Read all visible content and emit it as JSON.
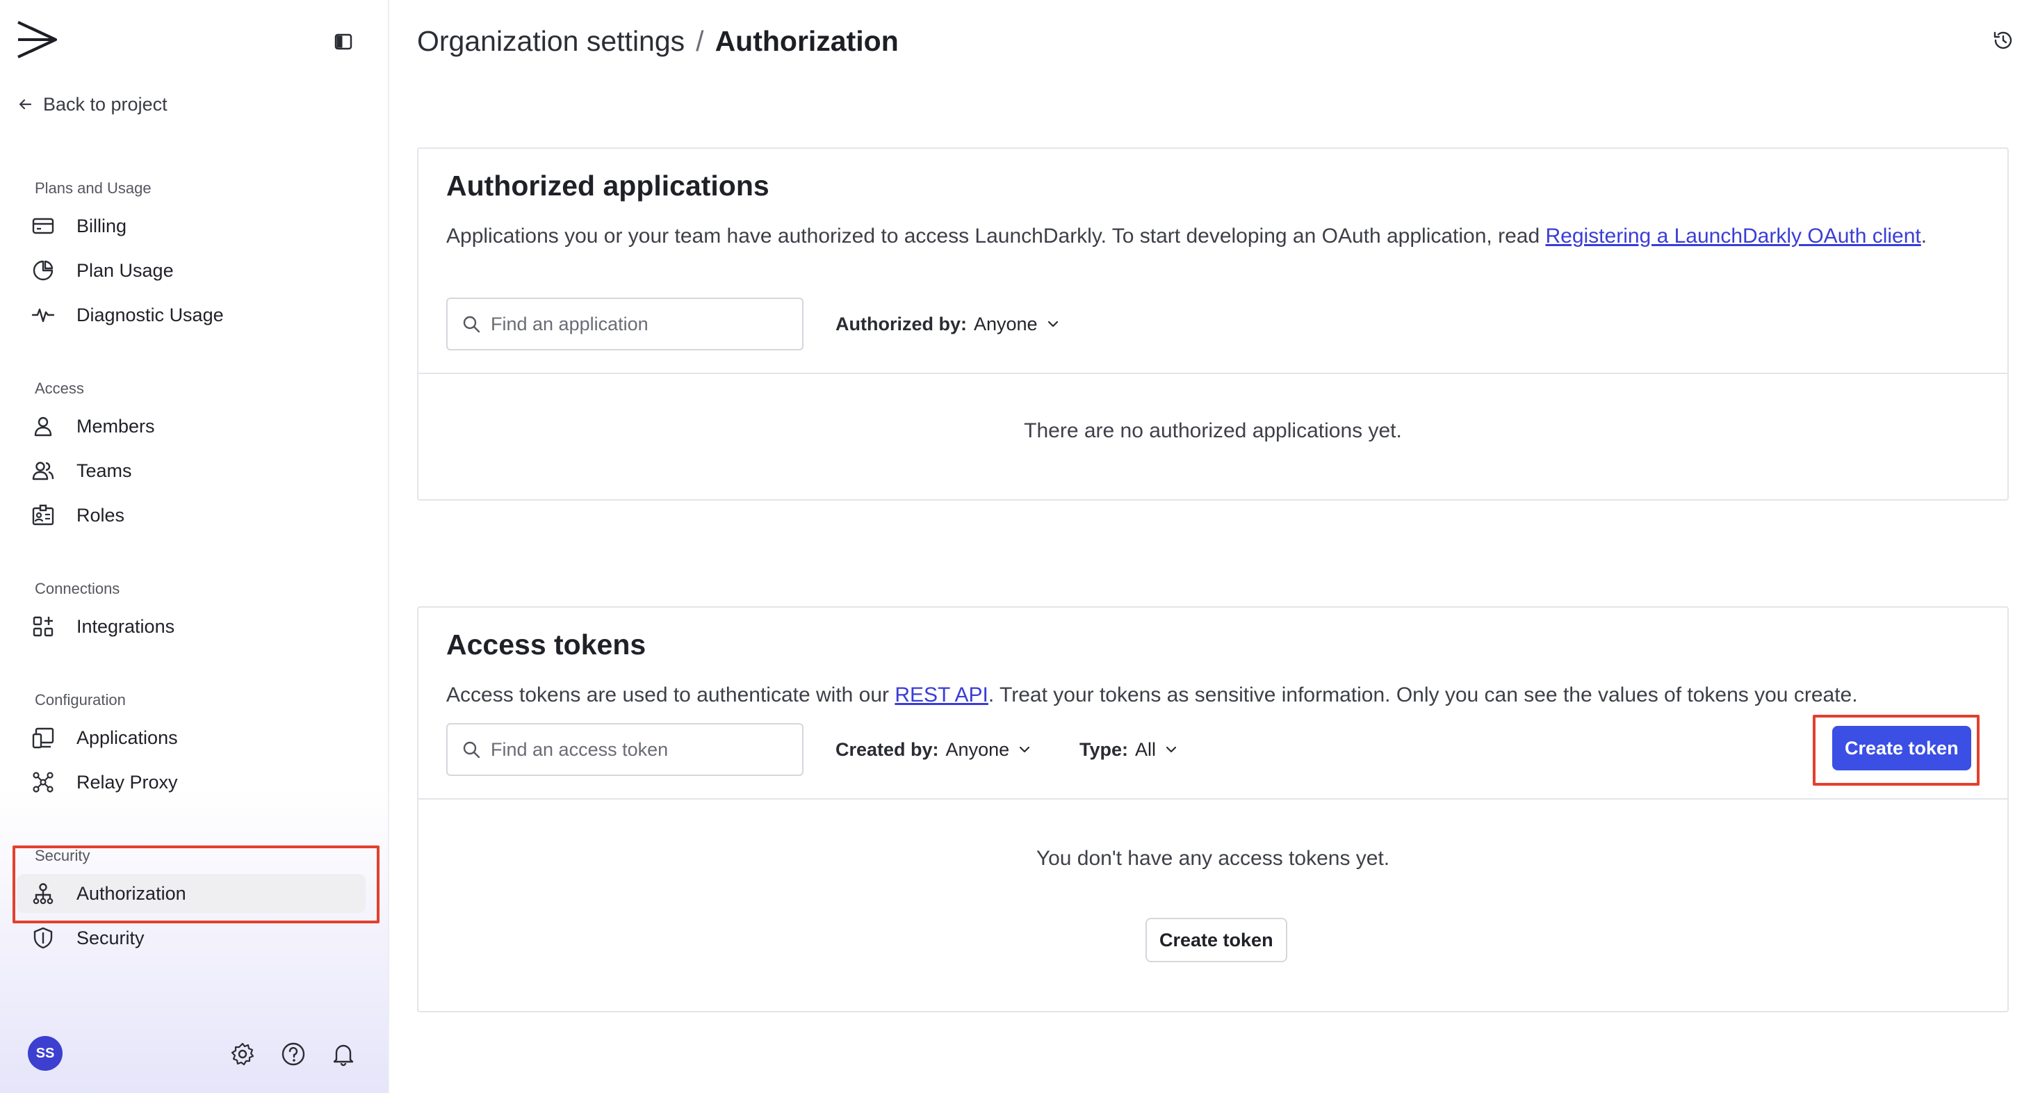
{
  "sidebar": {
    "back_label": "Back to project",
    "sections": {
      "plans": {
        "heading": "Plans and Usage",
        "items": [
          {
            "label": "Billing",
            "icon": "credit-card-icon"
          },
          {
            "label": "Plan Usage",
            "icon": "pie-chart-icon"
          },
          {
            "label": "Diagnostic Usage",
            "icon": "activity-icon"
          }
        ]
      },
      "access": {
        "heading": "Access",
        "items": [
          {
            "label": "Members",
            "icon": "user-icon"
          },
          {
            "label": "Teams",
            "icon": "users-icon"
          },
          {
            "label": "Roles",
            "icon": "id-badge-icon"
          }
        ]
      },
      "connections": {
        "heading": "Connections",
        "items": [
          {
            "label": "Integrations",
            "icon": "grid-plus-icon"
          }
        ]
      },
      "configuration": {
        "heading": "Configuration",
        "items": [
          {
            "label": "Applications",
            "icon": "devices-icon"
          },
          {
            "label": "Relay Proxy",
            "icon": "relay-icon"
          }
        ]
      },
      "security": {
        "heading": "Security",
        "items": [
          {
            "label": "Authorization",
            "icon": "org-chart-icon",
            "active": true
          },
          {
            "label": "Security",
            "icon": "shield-icon"
          }
        ]
      }
    },
    "footer": {
      "avatar_initials": "SS",
      "icons": [
        "gear-icon",
        "help-circle-icon",
        "bell-icon"
      ]
    }
  },
  "header": {
    "parent": "Organization settings",
    "separator": "/",
    "current": "Authorization"
  },
  "authorized_apps": {
    "title": "Authorized applications",
    "desc_prefix": "Applications you or your team have authorized to access LaunchDarkly. To start developing an OAuth application, read ",
    "desc_link": "Registering a LaunchDarkly OAuth client",
    "desc_suffix": ".",
    "search_placeholder": "Find an application",
    "filter_label": "Authorized by:",
    "filter_value": "Anyone",
    "empty": "There are no authorized applications yet."
  },
  "access_tokens": {
    "title": "Access tokens",
    "desc_prefix": "Access tokens are used to authenticate with our ",
    "desc_link": "REST API",
    "desc_suffix": ". Treat your tokens as sensitive information. Only you can see the values of tokens you create.",
    "search_placeholder": "Find an access token",
    "created_label": "Created by:",
    "created_value": "Anyone",
    "type_label": "Type:",
    "type_value": "All",
    "create_button": "Create token",
    "empty": "You don't have any access tokens yet.",
    "empty_button": "Create token"
  },
  "colors": {
    "accent": "#3b4fe4",
    "highlight": "#e3402e",
    "avatar": "#3c3fcf"
  }
}
